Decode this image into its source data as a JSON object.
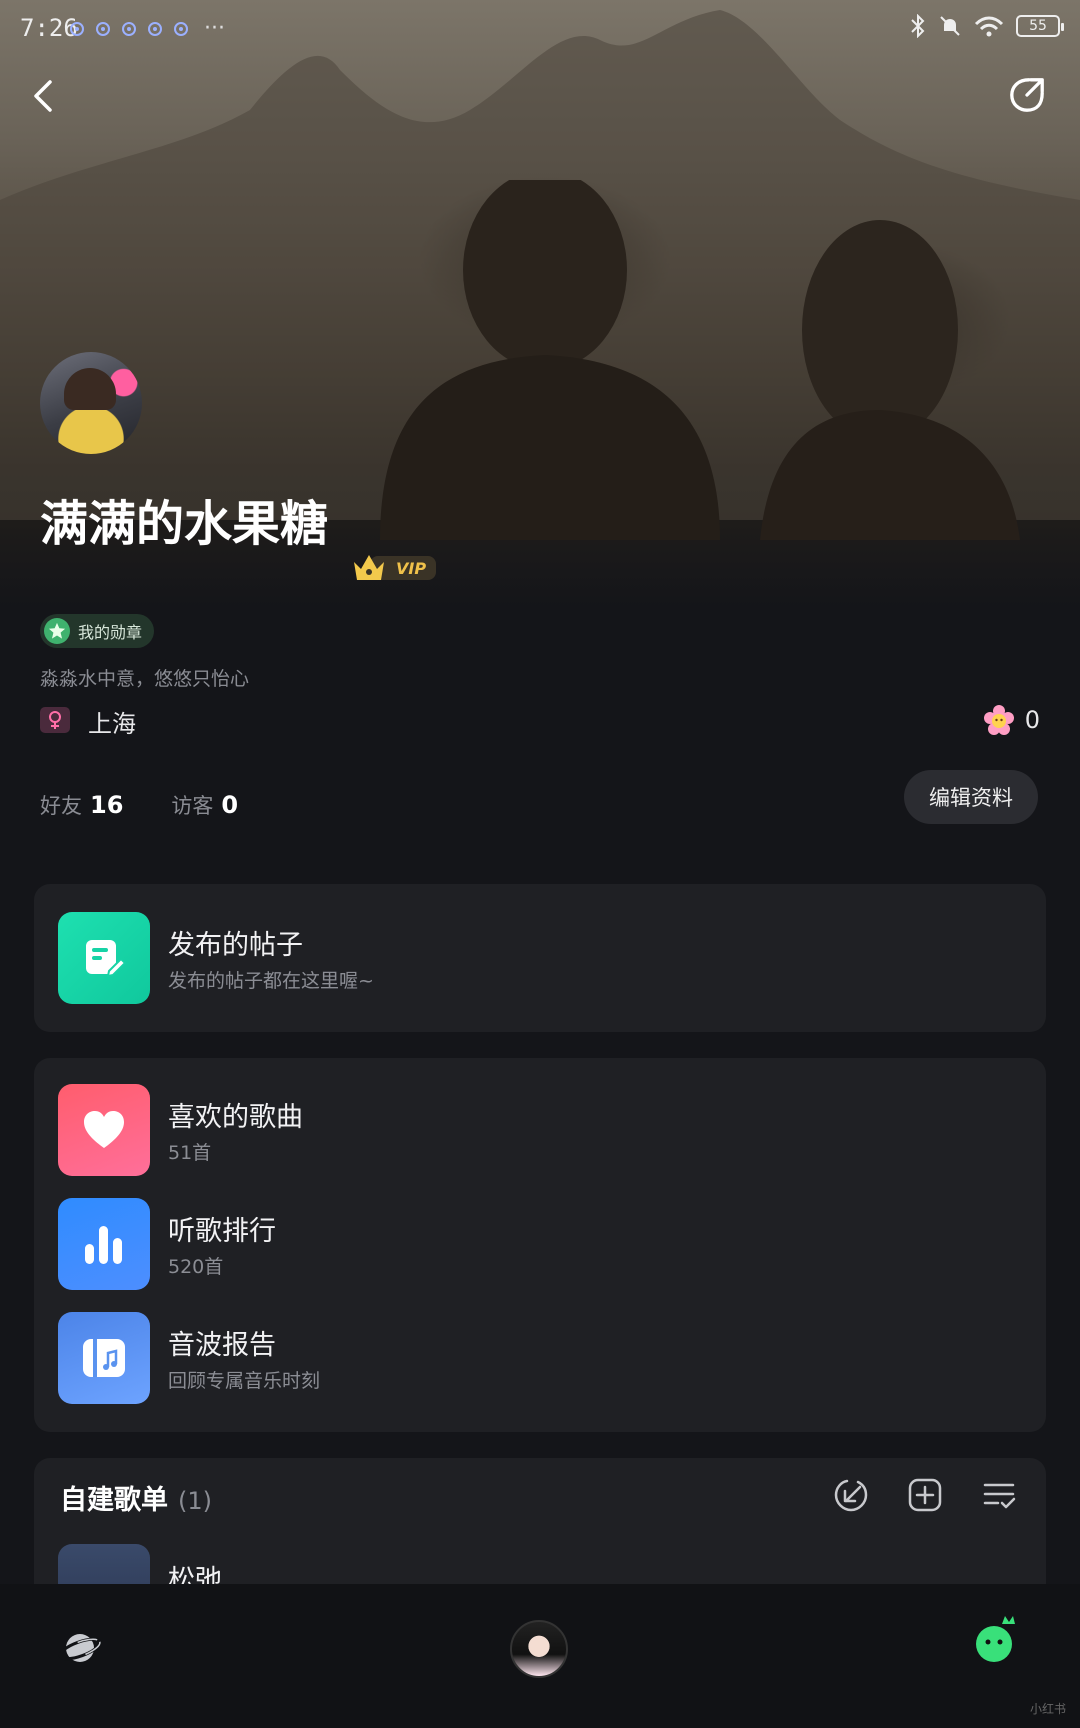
{
  "status_bar": {
    "time": "7:26",
    "more": "···",
    "battery": "55"
  },
  "profile": {
    "name": "满满的水果糖",
    "vip_label": "VIP",
    "medal_label": "我的勋章",
    "signature": "淼淼水中意，悠悠只怡心",
    "city": "上海",
    "flower_count": "0",
    "friends_label": "好友",
    "friends_count": "16",
    "visitors_label": "访客",
    "visitors_count": "0",
    "edit_label": "编辑资料"
  },
  "posts": {
    "title": "发布的帖子",
    "subtitle": "发布的帖子都在这里喔~"
  },
  "music": {
    "items": [
      {
        "title": "喜欢的歌曲",
        "subtitle": "51首",
        "icon": "heart-icon",
        "color": "#ff5f7e"
      },
      {
        "title": "听歌排行",
        "subtitle": "520首",
        "icon": "bar-chart-icon",
        "color": "#3d8bff"
      },
      {
        "title": "音波报告",
        "subtitle": "回顾专属音乐时刻",
        "icon": "music-report-icon",
        "color": "#5a93ef"
      }
    ]
  },
  "playlists": {
    "header": "自建歌单",
    "count": "(1)",
    "items": [
      {
        "title": "松弛"
      }
    ]
  },
  "watermark": "小红书",
  "colors": {
    "posts_green": "#17d9a8",
    "accent_green": "#39e07a"
  }
}
